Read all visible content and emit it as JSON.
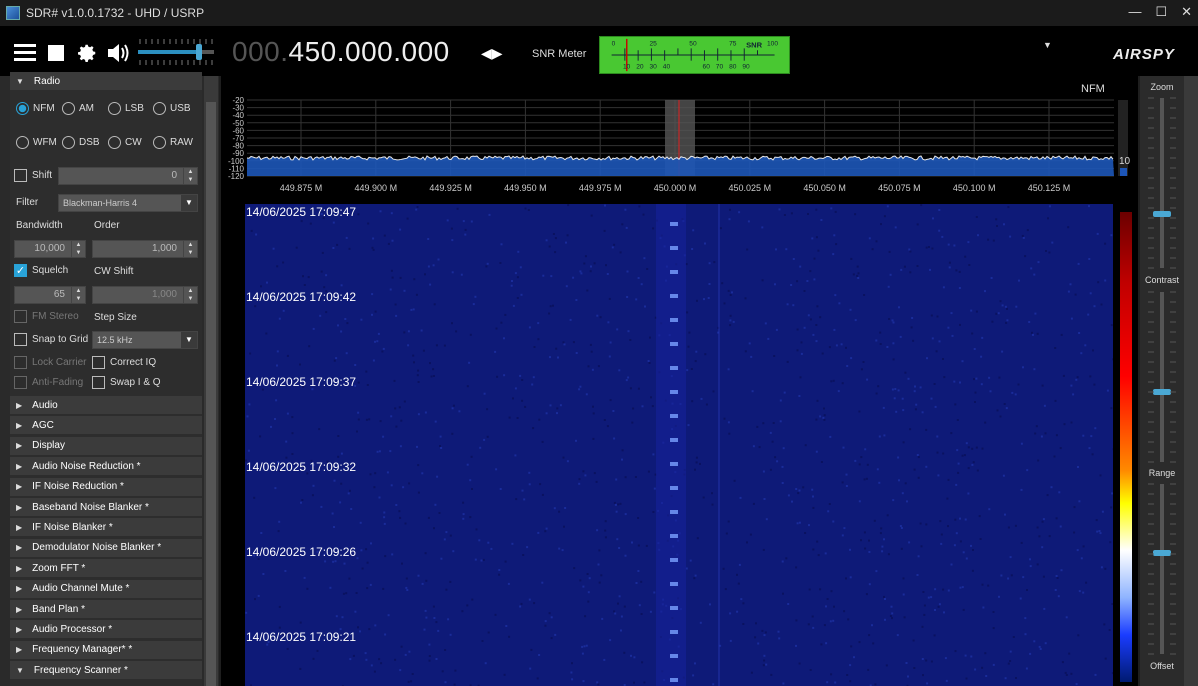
{
  "window": {
    "title": "SDR# v1.0.0.1732 - UHD / USRP",
    "minimize": "—",
    "maximize": "☐",
    "close": "✕"
  },
  "toolbar": {
    "freq_prefix": "000.",
    "freq_main": "450.000.000",
    "snr_label": "SNR Meter",
    "snr_scale_top": [
      "0",
      "25",
      "50",
      "75",
      "SNR",
      "100"
    ],
    "snr_scale_bottom": [
      "10",
      "20",
      "30",
      "40",
      "60",
      "70",
      "80",
      "90"
    ],
    "logo": "AIRSPY",
    "icons": [
      "menu-icon",
      "stop-icon",
      "gear-icon",
      "speaker-icon",
      "volume-slider",
      "tune-arrows-icon",
      "chevron-down-icon"
    ]
  },
  "radio": {
    "header": "Radio",
    "modes_row1": [
      "NFM",
      "AM",
      "LSB",
      "USB"
    ],
    "modes_row2": [
      "WFM",
      "DSB",
      "CW",
      "RAW"
    ],
    "selected_mode": "NFM",
    "shift_label": "Shift",
    "shift_value": "0",
    "filter_label": "Filter",
    "filter_value": "Blackman-Harris 4",
    "bandwidth_label": "Bandwidth",
    "bandwidth_value": "10,000",
    "order_label": "Order",
    "order_value": "1,000",
    "squelch_label": "Squelch",
    "squelch_value": "65",
    "cwshift_label": "CW Shift",
    "cwshift_value": "1,000",
    "fmstereo_label": "FM Stereo",
    "stepsize_label": "Step Size",
    "snap_label": "Snap to Grid",
    "stepsize_value": "12.5 kHz",
    "lockcarrier_label": "Lock Carrier",
    "correctiq_label": "Correct IQ",
    "antifading_label": "Anti-Fading",
    "swapiq_label": "Swap I & Q"
  },
  "sections": [
    {
      "label": "Audio"
    },
    {
      "label": "AGC"
    },
    {
      "label": "Display"
    },
    {
      "label": "Audio Noise Reduction *"
    },
    {
      "label": "IF Noise Reduction *"
    },
    {
      "label": "Baseband Noise Blanker *"
    },
    {
      "label": "IF Noise Blanker *"
    },
    {
      "label": "Demodulator Noise Blanker *"
    },
    {
      "label": "Zoom FFT *"
    },
    {
      "label": "Audio Channel Mute *"
    },
    {
      "label": "Band Plan *"
    },
    {
      "label": "Audio Processor *"
    },
    {
      "label": "Frequency Manager* *"
    },
    {
      "label": "Frequency Scanner *"
    }
  ],
  "spectrum": {
    "mode_label": "NFM",
    "db_labels": [
      "-20",
      "-30",
      "-40",
      "-50",
      "-60",
      "-70",
      "-80",
      "-90",
      "-100",
      "-110",
      "-120"
    ],
    "freq_labels": [
      "449.875 M",
      "449.900 M",
      "449.925 M",
      "449.950 M",
      "449.975 M",
      "450.000 M",
      "450.025 M",
      "450.050 M",
      "450.075 M",
      "450.100 M",
      "450.125 M"
    ],
    "side_value": "10"
  },
  "waterfall": {
    "timestamps": [
      "14/06/2025 17:09:47",
      "14/06/2025 17:09:42",
      "14/06/2025 17:09:37",
      "14/06/2025 17:09:32",
      "14/06/2025 17:09:26",
      "14/06/2025 17:09:21"
    ]
  },
  "right_panel": {
    "zoom": "Zoom",
    "contrast": "Contrast",
    "range": "Range",
    "offset": "Offset"
  },
  "colors": {
    "accent": "#29a3d8",
    "waterfall_bg": "#0e1a78",
    "snr_meter": "#49c832"
  }
}
